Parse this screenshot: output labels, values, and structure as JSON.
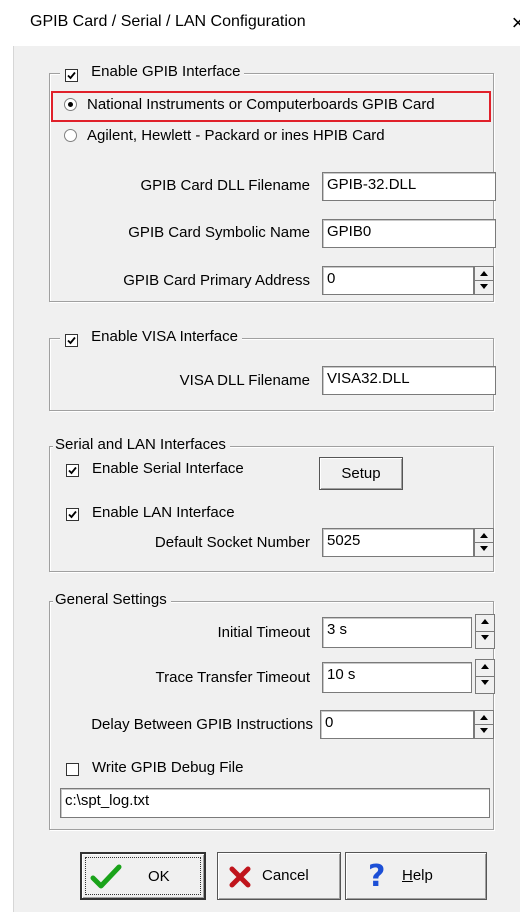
{
  "window": {
    "title": "GPIB Card / Serial / LAN Configuration",
    "close_glyph": "×"
  },
  "gpib": {
    "enable_label": "Enable GPIB Interface",
    "enabled": true,
    "radio_ni_label": "National Instruments or Computerboards GPIB Card",
    "radio_agilent_label": "Agilent, Hewlett - Packard or ines HPIB Card",
    "selected_card": "national-instruments",
    "dll_label": "GPIB Card DLL Filename",
    "dll_value": "GPIB-32.DLL",
    "symbolic_label": "GPIB Card Symbolic Name",
    "symbolic_value": "GPIB0",
    "address_label": "GPIB Card Primary Address",
    "address_value": "0"
  },
  "visa": {
    "enable_label": "Enable VISA Interface",
    "enabled": true,
    "dll_label": "VISA DLL Filename",
    "dll_value": "VISA32.DLL"
  },
  "serial_lan": {
    "group_label": "Serial and LAN Interfaces",
    "serial_label": "Enable Serial Interface",
    "serial_enabled": true,
    "setup_label": "Setup",
    "lan_label": "Enable LAN Interface",
    "lan_enabled": true,
    "socket_label": "Default Socket Number",
    "socket_value": "5025"
  },
  "general": {
    "group_label": "General Settings",
    "initial_timeout_label": "Initial Timeout",
    "initial_timeout_value": "3 s",
    "trace_timeout_label": "Trace Transfer Timeout",
    "trace_timeout_value": "10 s",
    "delay_label": "Delay Between GPIB Instructions",
    "delay_value": "0",
    "debug_label": "Write GPIB Debug File",
    "debug_enabled": false,
    "debug_path": "c:\\spt_log.txt"
  },
  "buttons": {
    "ok_label": "OK",
    "cancel_label": "Cancel",
    "help_label_underlined": "H",
    "help_label_rest": "elp"
  },
  "colors": {
    "highlight": "#e0202a",
    "ok_check": "#1aa31a",
    "cancel_x": "#c0141c",
    "help_q": "#1c4fd6"
  },
  "icons": {
    "ok": "checkmark-icon",
    "cancel": "x-icon",
    "help": "question-icon"
  }
}
